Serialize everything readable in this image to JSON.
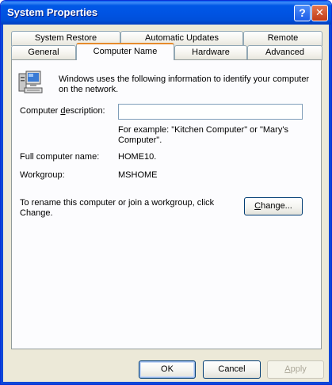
{
  "window": {
    "title": "System Properties",
    "help_glyph": "?",
    "close_glyph": "✕"
  },
  "tabs_row1": [
    {
      "label": "System Restore"
    },
    {
      "label": "Automatic Updates"
    },
    {
      "label": "Remote"
    }
  ],
  "tabs_row2": [
    {
      "label": "General"
    },
    {
      "label": "Computer Name",
      "active": true
    },
    {
      "label": "Hardware"
    },
    {
      "label": "Advanced"
    }
  ],
  "panel": {
    "intro_text": "Windows uses the following information to identify your computer on the network.",
    "description_label_pre": "Computer ",
    "description_label_accel": "d",
    "description_label_post": "escription:",
    "description_value": "",
    "example_text": "For example: \"Kitchen Computer\" or \"Mary's Computer\".",
    "full_name_label": "Full computer name:",
    "full_name_value": "HOME10.",
    "workgroup_label": "Workgroup:",
    "workgroup_value": "MSHOME",
    "rename_text": "To rename this computer or join a workgroup, click Change.",
    "change_accel": "C",
    "change_rest": "hange..."
  },
  "footer": {
    "ok_label": "OK",
    "cancel_label": "Cancel",
    "apply_accel": "A",
    "apply_rest": "pply"
  },
  "colors": {
    "titlebar": "#0054e3",
    "active_tab_highlight": "#e68b2c",
    "dialog_face": "#ece9d8"
  }
}
